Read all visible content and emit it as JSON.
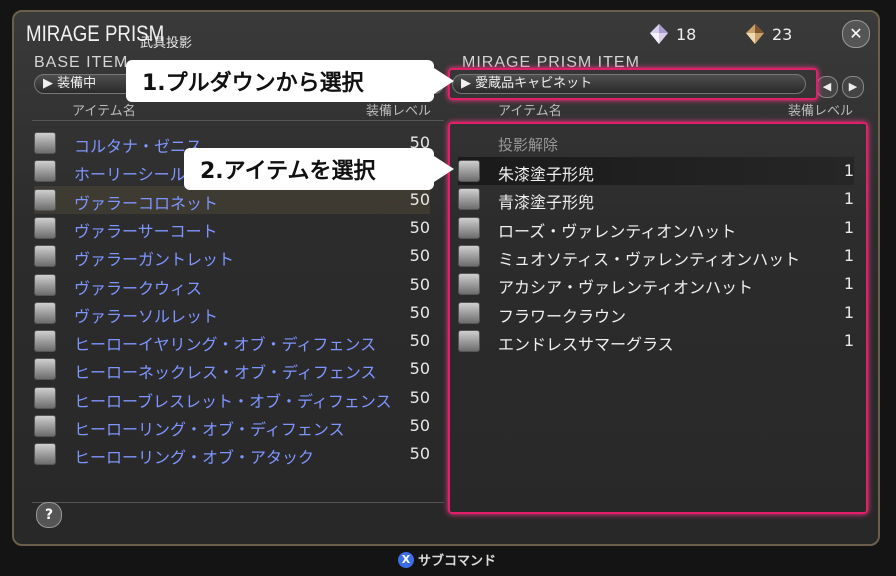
{
  "window": {
    "title": "MIRAGE PRISM",
    "subtitle": "武具投影",
    "currency1": "18",
    "currency2": "23",
    "close_icon": "x-icon"
  },
  "left_panel": {
    "header": "BASE ITEM",
    "dropdown": "装備中",
    "col_name": "アイテム名",
    "col_level": "装備レベル",
    "items": [
      {
        "name": "コルタナ・ゼニス",
        "value": "50"
      },
      {
        "name": "ホーリーシールド・ゼニス",
        "value": "50"
      },
      {
        "name": "ヴァラーコロネット",
        "value": "50"
      },
      {
        "name": "ヴァラーサーコート",
        "value": "50"
      },
      {
        "name": "ヴァラーガントレット",
        "value": "50"
      },
      {
        "name": "ヴァラークウィス",
        "value": "50"
      },
      {
        "name": "ヴァラーソルレット",
        "value": "50"
      },
      {
        "name": "ヒーローイヤリング・オブ・ディフェンス",
        "value": "50"
      },
      {
        "name": "ヒーローネックレス・オブ・ディフェンス",
        "value": "50"
      },
      {
        "name": "ヒーローブレスレット・オブ・ディフェンス",
        "value": "50"
      },
      {
        "name": "ヒーローリング・オブ・ディフェンス",
        "value": "50"
      },
      {
        "name": "ヒーローリング・オブ・アタック",
        "value": "50"
      }
    ]
  },
  "right_panel": {
    "header": "MIRAGE PRISM ITEM",
    "dropdown": "愛蔵品キャビネット",
    "col_name": "アイテム名",
    "col_level": "装備レベル",
    "clear_label": "投影解除",
    "items": [
      {
        "name": "朱漆塗子形兜",
        "value": "1"
      },
      {
        "name": "青漆塗子形兜",
        "value": "1"
      },
      {
        "name": "ローズ・ヴァレンティオンハット",
        "value": "1"
      },
      {
        "name": "ミュオソティス・ヴァレンティオンハット",
        "value": "1"
      },
      {
        "name": "アカシア・ヴァレンティオンハット",
        "value": "1"
      },
      {
        "name": "フラワークラウン",
        "value": "1"
      },
      {
        "name": "エンドレスサマーグラス",
        "value": "1"
      }
    ]
  },
  "callouts": {
    "step1": "1.プルダウンから選択",
    "step2": "2.アイテムを選択"
  },
  "footer": {
    "help": "?",
    "subcommand_button": "X",
    "subcommand": "サブコマンド"
  },
  "colors": {
    "accent_pink": "#e11f6a",
    "item_blue": "#7f95ff"
  }
}
